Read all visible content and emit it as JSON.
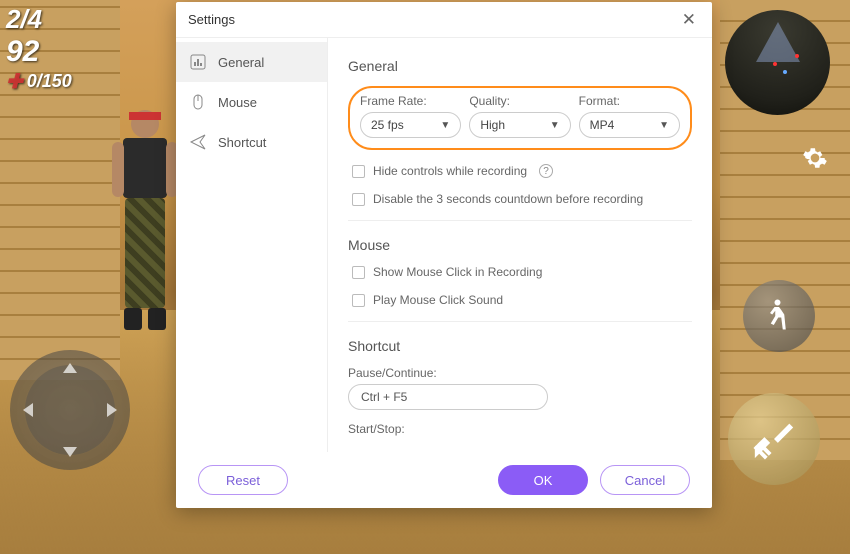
{
  "hud": {
    "score": "2/4",
    "ammo": "92",
    "hp": "0/150"
  },
  "dialog": {
    "title": "Settings",
    "sidebar": {
      "items": [
        {
          "label": "General"
        },
        {
          "label": "Mouse"
        },
        {
          "label": "Shortcut"
        }
      ]
    },
    "general": {
      "title": "General",
      "frameRate": {
        "label": "Frame Rate:",
        "value": "25 fps"
      },
      "quality": {
        "label": "Quality:",
        "value": "High"
      },
      "format": {
        "label": "Format:",
        "value": "MP4"
      },
      "hideControls": "Hide controls while recording",
      "disableCountdown": "Disable the 3 seconds countdown before recording"
    },
    "mouse": {
      "title": "Mouse",
      "showClick": "Show Mouse Click in Recording",
      "playSound": "Play Mouse Click Sound"
    },
    "shortcut": {
      "title": "Shortcut",
      "pauseLabel": "Pause/Continue:",
      "pauseValue": "Ctrl + F5",
      "startLabel": "Start/Stop:"
    },
    "buttons": {
      "reset": "Reset",
      "ok": "OK",
      "cancel": "Cancel"
    }
  }
}
